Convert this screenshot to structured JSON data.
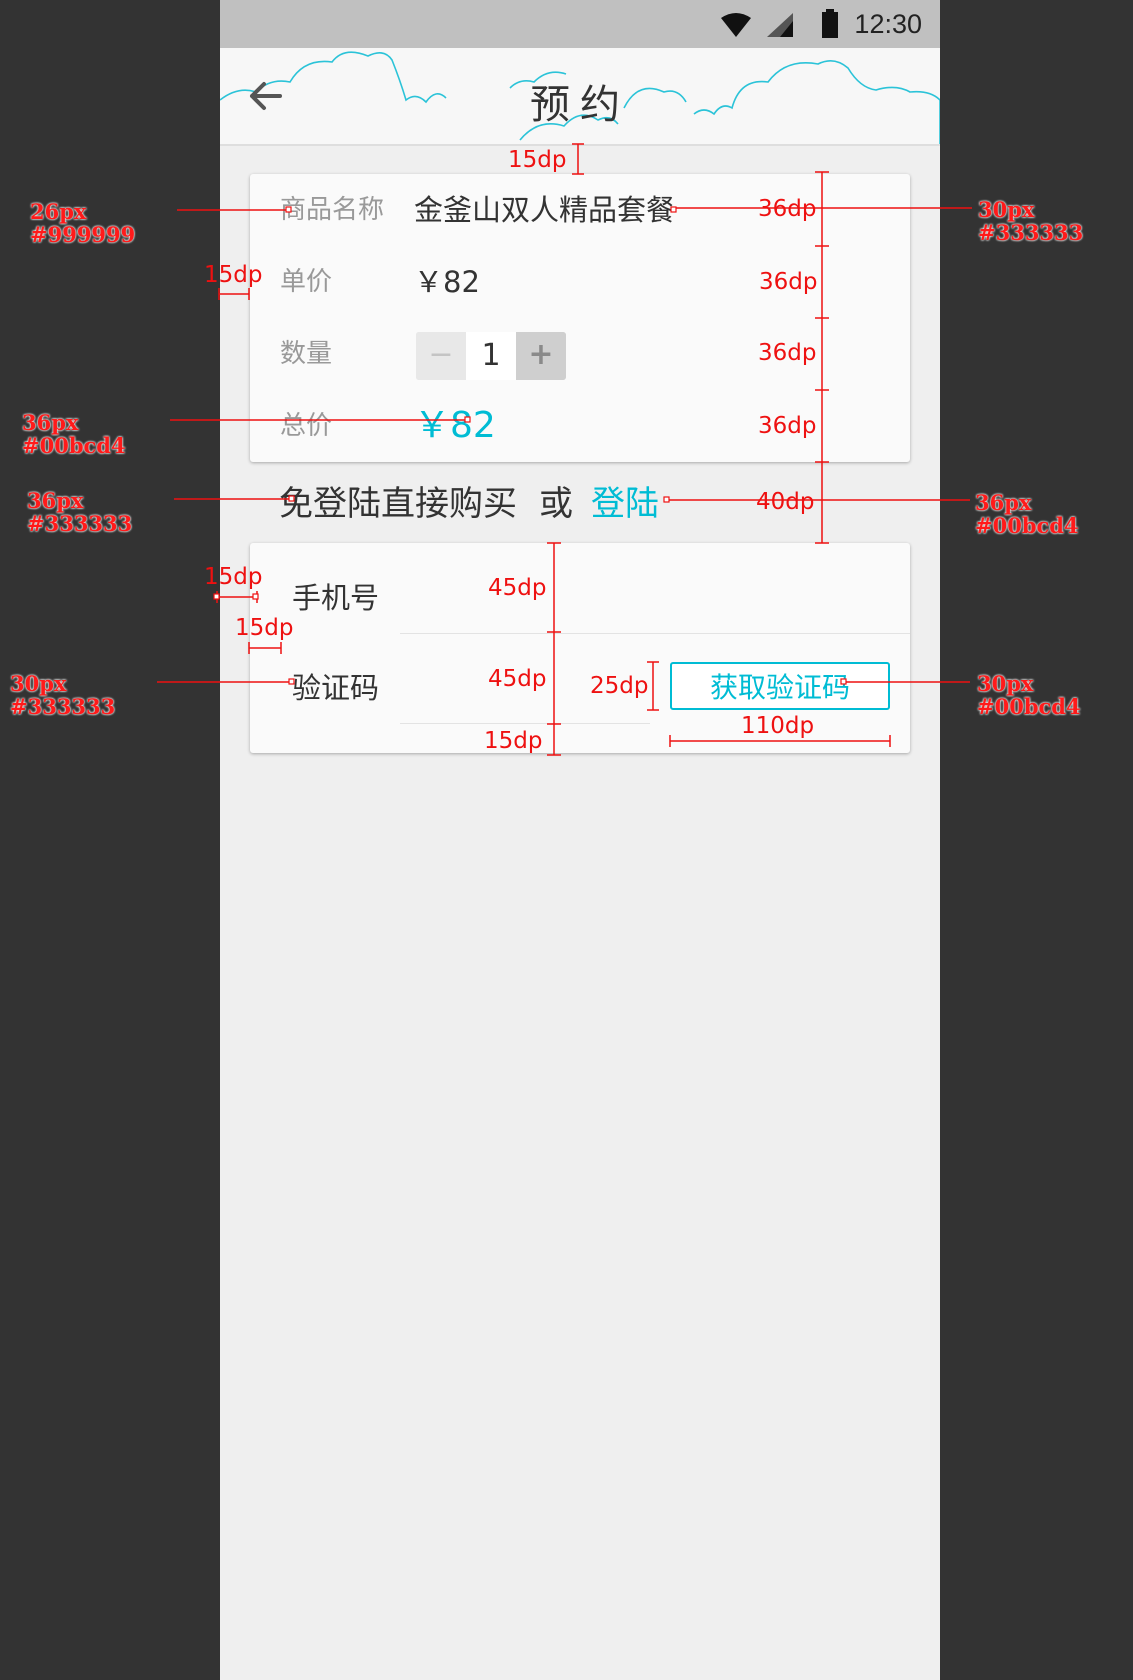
{
  "status_bar": {
    "time": "12:30"
  },
  "app_bar": {
    "title": "预约"
  },
  "order": {
    "name_label": "商品名称",
    "name_value": "金釜山双人精品套餐",
    "price_label": "单价",
    "price_value": "￥82",
    "qty_label": "数量",
    "qty_minus": "−",
    "qty_value": "1",
    "qty_plus": "+",
    "total_label": "总价",
    "total_value": "￥82"
  },
  "login": {
    "prompt": "免登陆直接购买",
    "or": "或",
    "link": "登陆"
  },
  "form": {
    "phone_label": "手机号",
    "code_label": "验证码",
    "get_code_button": "获取验证码"
  },
  "annotations": {
    "spec_label_font": [
      "26px",
      "#999999"
    ],
    "spec_value_font": [
      "30px",
      "#333333"
    ],
    "spec_total_font": [
      "36px",
      "#00bcd4"
    ],
    "spec_login_font": [
      "36px",
      "#333333"
    ],
    "spec_login_link_font": [
      "36px",
      "#00bcd4"
    ],
    "spec_form_label_font": [
      "30px",
      "#333333"
    ],
    "spec_button_font": [
      "30px",
      "#00bcd4"
    ],
    "gap_top": "15dp",
    "row_height": "36dp",
    "login_height": "40dp",
    "field_height": "45dp",
    "button_height": "25dp",
    "button_width": "110dp",
    "margin": "15dp"
  },
  "colors": {
    "accent": "#00bcd4",
    "text_primary": "#333333",
    "text_secondary": "#999999",
    "annotation": "#ff0000"
  }
}
